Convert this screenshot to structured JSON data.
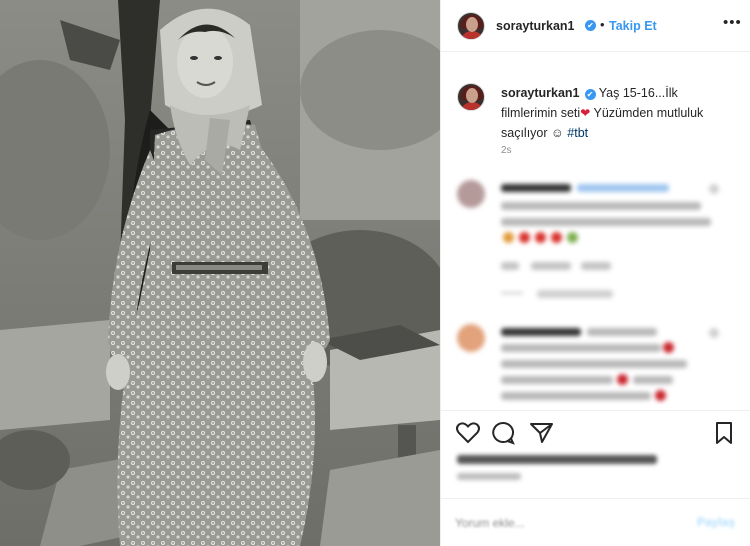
{
  "post": {
    "username": "sorayturkan1",
    "follow_label": "Takip Et",
    "separator": "•",
    "more_glyph": "•••",
    "verified_glyph": "✔",
    "caption_rest_1": " Yaş 15-16...İlk filmlerimin seti",
    "caption_emoji": "❤",
    "caption_rest_2": " Yüzümden mutluluk saçılıyor ☺",
    "hashtag": "#tbt",
    "time_ago": "2s"
  },
  "actions": {
    "like_icon": "heart-outline-icon",
    "comment_icon": "comment-bubble-icon",
    "share_icon": "paper-plane-icon",
    "save_icon": "bookmark-icon"
  },
  "comment_form": {
    "placeholder": "Yorum ekle...",
    "post_label": "Paylaş"
  },
  "colors": {
    "accent": "#3897f0",
    "text": "#262626",
    "muted": "#8e8e8e",
    "border": "#efefef"
  }
}
